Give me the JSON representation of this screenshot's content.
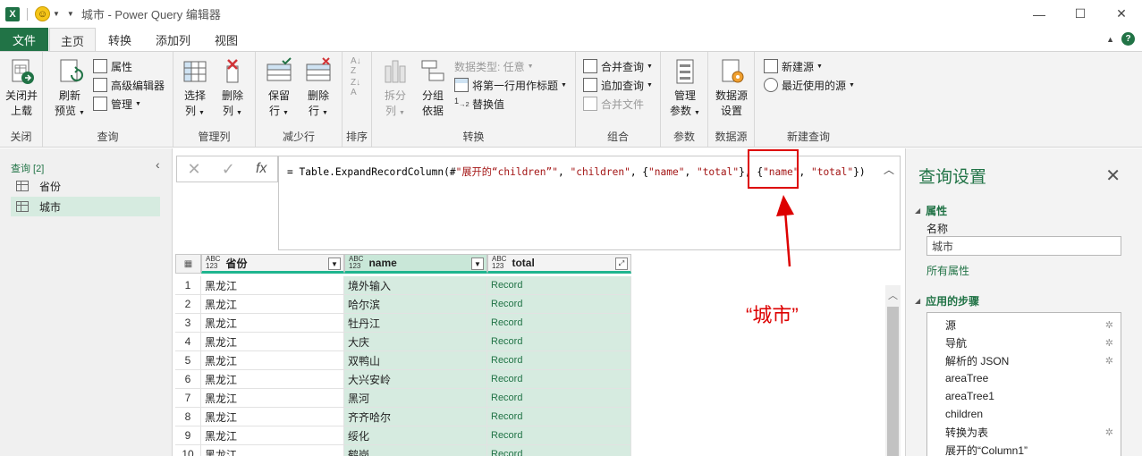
{
  "titlebar": {
    "app_logo": "X",
    "title_sep": "|",
    "window_title": "城市 - Power Query 编辑器",
    "controls": {
      "minimize": "—",
      "maximize": "☐",
      "close": "✕"
    }
  },
  "menu": {
    "file": "文件",
    "tabs": [
      "主页",
      "转换",
      "添加列",
      "视图"
    ],
    "active_tab": "主页"
  },
  "ribbon": {
    "close_load": "关闭并\n上载",
    "group_close": "关闭",
    "refresh_preview": "刷新\n预览",
    "properties": "属性",
    "advanced_editor": "高级编辑器",
    "manage": "管理",
    "group_query": "查询",
    "choose_columns": "选择\n列",
    "remove_columns": "删除\n列",
    "group_manage_columns": "管理列",
    "keep_rows": "保留\n行",
    "remove_rows": "删除\n行",
    "group_reduce_rows": "减少行",
    "group_sort": "排序",
    "split_column": "拆分\n列",
    "group_by": "分组\n依据",
    "data_type": "数据类型: 任意",
    "first_row_header": "将第一行用作标题",
    "replace_values": "替换值",
    "group_transform": "转换",
    "merge_queries": "合并查询",
    "append_queries": "追加查询",
    "combine_files": "合并文件",
    "group_combine": "组合",
    "manage_params": "管理\n参数",
    "group_params": "参数",
    "data_source_settings": "数据源\n设置",
    "group_data_source": "数据源",
    "new_source": "新建源",
    "recent_sources": "最近使用的源",
    "group_new_query": "新建查询"
  },
  "queries_panel": {
    "header": "查询 [2]",
    "items": [
      "省份",
      "城市"
    ],
    "selected": "城市"
  },
  "formula_bar": {
    "cancel": "✕",
    "commit": "✓",
    "fx": "fx",
    "text": "= Table.ExpandRecordColumn(#\"展开的“children”\", \"children\", {\"name\", \"total\"}, {\"name\", \"total\"})"
  },
  "annotation": {
    "text": "“城市”",
    "color": "#dd0000"
  },
  "grid": {
    "columns": [
      {
        "type": "ABC\n123",
        "name": "省份"
      },
      {
        "type": "ABC\n123",
        "name": "name"
      },
      {
        "type": "ABC\n123",
        "name": "total"
      }
    ],
    "rows": [
      {
        "n": "1",
        "province": "黑龙江",
        "name": "境外输入",
        "total": "Record"
      },
      {
        "n": "2",
        "province": "黑龙江",
        "name": "哈尔滨",
        "total": "Record"
      },
      {
        "n": "3",
        "province": "黑龙江",
        "name": "牡丹江",
        "total": "Record"
      },
      {
        "n": "4",
        "province": "黑龙江",
        "name": "大庆",
        "total": "Record"
      },
      {
        "n": "5",
        "province": "黑龙江",
        "name": "双鸭山",
        "total": "Record"
      },
      {
        "n": "6",
        "province": "黑龙江",
        "name": "大兴安岭",
        "total": "Record"
      },
      {
        "n": "7",
        "province": "黑龙江",
        "name": "黑河",
        "total": "Record"
      },
      {
        "n": "8",
        "province": "黑龙江",
        "name": "齐齐哈尔",
        "total": "Record"
      },
      {
        "n": "9",
        "province": "黑龙江",
        "name": "绥化",
        "total": "Record"
      },
      {
        "n": "10",
        "province": "黑龙江",
        "name": "鹤岗",
        "total": "Record"
      }
    ]
  },
  "settings": {
    "title": "查询设置",
    "close": "✕",
    "properties_head": "属性",
    "name_label": "名称",
    "name_value": "城市",
    "all_properties": "所有属性",
    "steps_head": "应用的步骤",
    "steps": [
      {
        "label": "源",
        "gear": true
      },
      {
        "label": "导航",
        "gear": true
      },
      {
        "label": "解析的 JSON",
        "gear": true
      },
      {
        "label": "areaTree",
        "gear": false
      },
      {
        "label": "areaTree1",
        "gear": false
      },
      {
        "label": "children",
        "gear": false
      },
      {
        "label": "转换为表",
        "gear": true
      },
      {
        "label": "展开的“Column1”",
        "gear": false
      }
    ]
  },
  "colors": {
    "accent": "#217346",
    "header_underline": "#1fb58f",
    "selected_column": "#d6ebe0",
    "annotation_red": "#dd0000"
  }
}
